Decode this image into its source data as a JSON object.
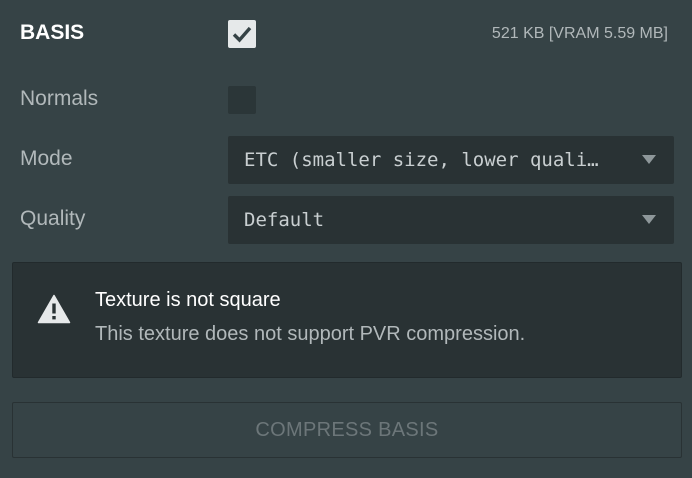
{
  "panel": {
    "title": "BASIS",
    "size_info": "521 KB [VRAM 5.59 MB]",
    "basis_enabled": true
  },
  "normals": {
    "label": "Normals",
    "checked": false
  },
  "mode": {
    "label": "Mode",
    "value": "ETC (smaller size, lower quali…"
  },
  "quality": {
    "label": "Quality",
    "value": "Default"
  },
  "alert": {
    "icon": "warning-icon",
    "title": "Texture is not square",
    "message": "This texture does not support PVR compression."
  },
  "compress_button": {
    "label": "COMPRESS BASIS"
  },
  "colors": {
    "background": "#364346",
    "field": "#293234",
    "text": "#b1b8ba",
    "heading": "#ffffff",
    "disabled_text": "#6c7679"
  }
}
